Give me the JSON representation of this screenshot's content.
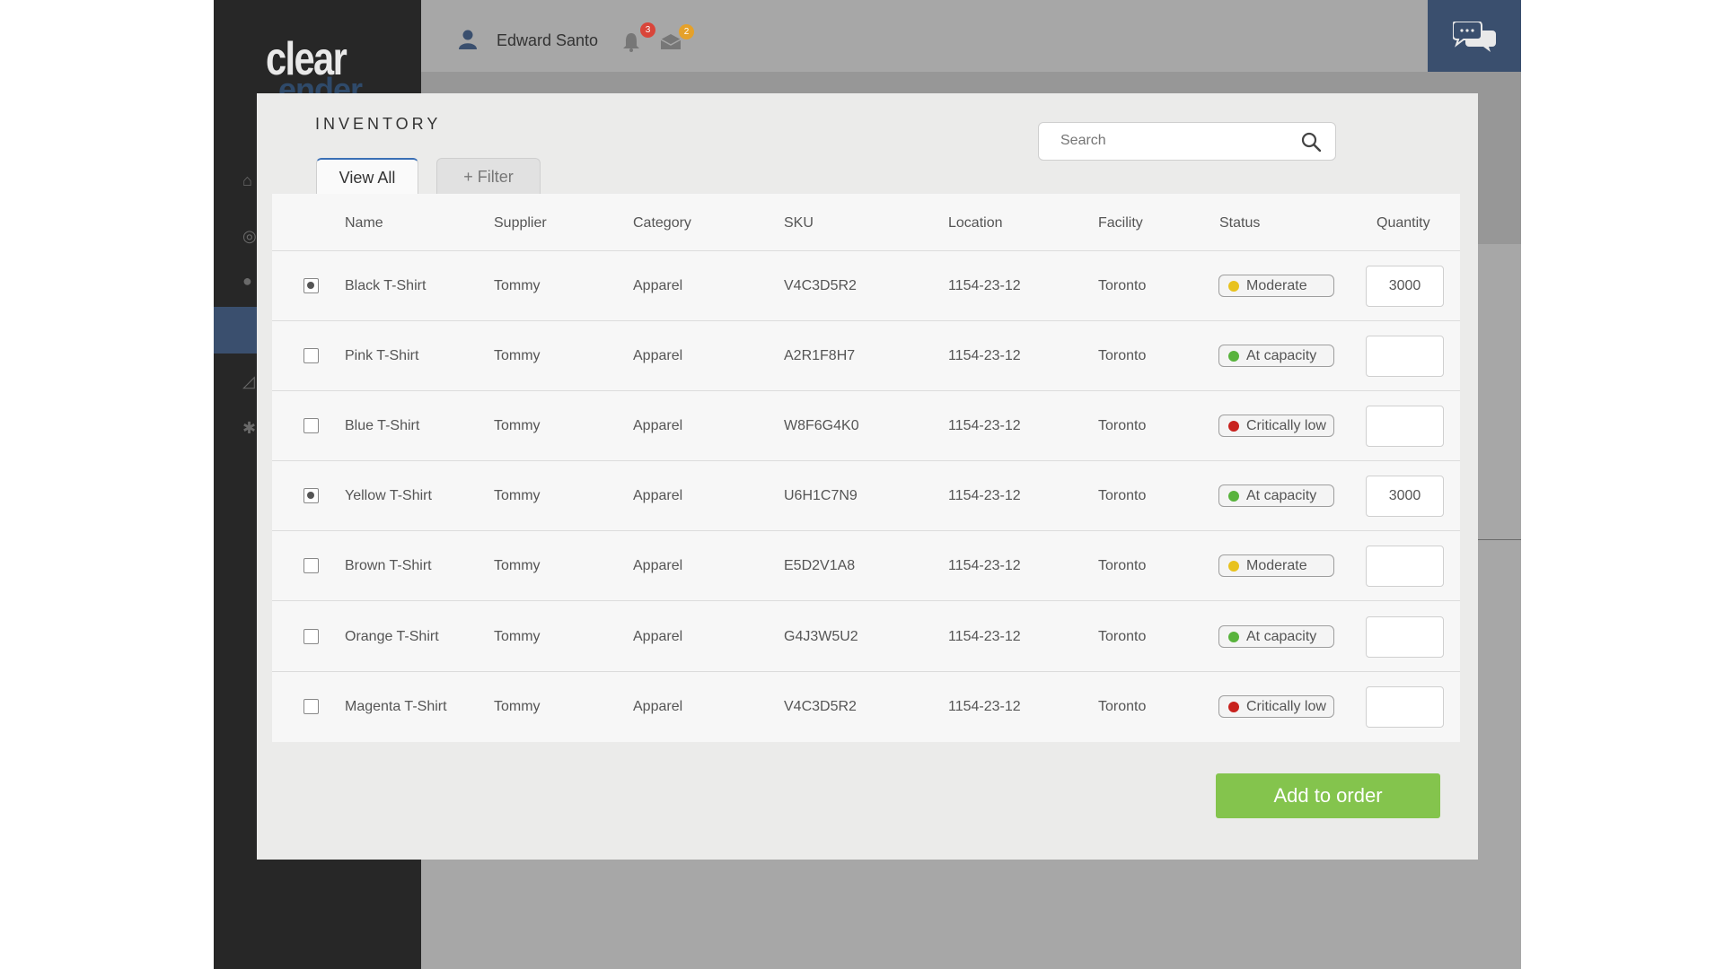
{
  "app": {
    "logo_line1": "clear",
    "logo_line2": "ender"
  },
  "topbar": {
    "user_name": "Edward Santo",
    "notifications_count": "3",
    "messages_count": "2",
    "colors": {
      "notification_badge": "#d9453a",
      "message_badge": "#e5a12a",
      "chat_panel": "#3a4f6e"
    }
  },
  "modal": {
    "title": "INVENTORY",
    "search_placeholder": "Search",
    "tabs": [
      {
        "label": "View All",
        "active": true
      },
      {
        "label": "+ Filter",
        "active": false
      }
    ],
    "columns": [
      "Name",
      "Supplier",
      "Category",
      "SKU",
      "Location",
      "Facility",
      "Status",
      "Quantity"
    ],
    "rows": [
      {
        "checked": true,
        "name": "Black T-Shirt",
        "supplier": "Tommy",
        "category": "Apparel",
        "sku": "V4C3D5R2",
        "location": "1154-23-12",
        "facility": "Toronto",
        "status": "Moderate",
        "status_color": "#e8c21e",
        "quantity": "3000"
      },
      {
        "checked": false,
        "name": "Pink T-Shirt",
        "supplier": "Tommy",
        "category": "Apparel",
        "sku": "A2R1F8H7",
        "location": "1154-23-12",
        "facility": "Toronto",
        "status": "At capacity",
        "status_color": "#58b33c",
        "quantity": ""
      },
      {
        "checked": false,
        "name": "Blue T-Shirt",
        "supplier": "Tommy",
        "category": "Apparel",
        "sku": "W8F6G4K0",
        "location": "1154-23-12",
        "facility": "Toronto",
        "status": "Critically low",
        "status_color": "#c8221e",
        "quantity": ""
      },
      {
        "checked": true,
        "name": "Yellow T-Shirt",
        "supplier": "Tommy",
        "category": "Apparel",
        "sku": "U6H1C7N9",
        "location": "1154-23-12",
        "facility": "Toronto",
        "status": "At capacity",
        "status_color": "#58b33c",
        "quantity": "3000"
      },
      {
        "checked": false,
        "name": "Brown T-Shirt",
        "supplier": "Tommy",
        "category": "Apparel",
        "sku": "E5D2V1A8",
        "location": "1154-23-12",
        "facility": "Toronto",
        "status": "Moderate",
        "status_color": "#e8c21e",
        "quantity": ""
      },
      {
        "checked": false,
        "name": "Orange T-Shirt",
        "supplier": "Tommy",
        "category": "Apparel",
        "sku": "G4J3W5U2",
        "location": "1154-23-12",
        "facility": "Toronto",
        "status": "At capacity",
        "status_color": "#58b33c",
        "quantity": ""
      },
      {
        "checked": false,
        "name": "Magenta T-Shirt",
        "supplier": "Tommy",
        "category": "Apparel",
        "sku": "V4C3D5R2",
        "location": "1154-23-12",
        "facility": "Toronto",
        "status": "Critically low",
        "status_color": "#c8221e",
        "quantity": ""
      }
    ],
    "add_button_label": "Add to order",
    "colors": {
      "add_button": "#84c44d",
      "active_tab_accent": "#3a6fb5"
    }
  }
}
